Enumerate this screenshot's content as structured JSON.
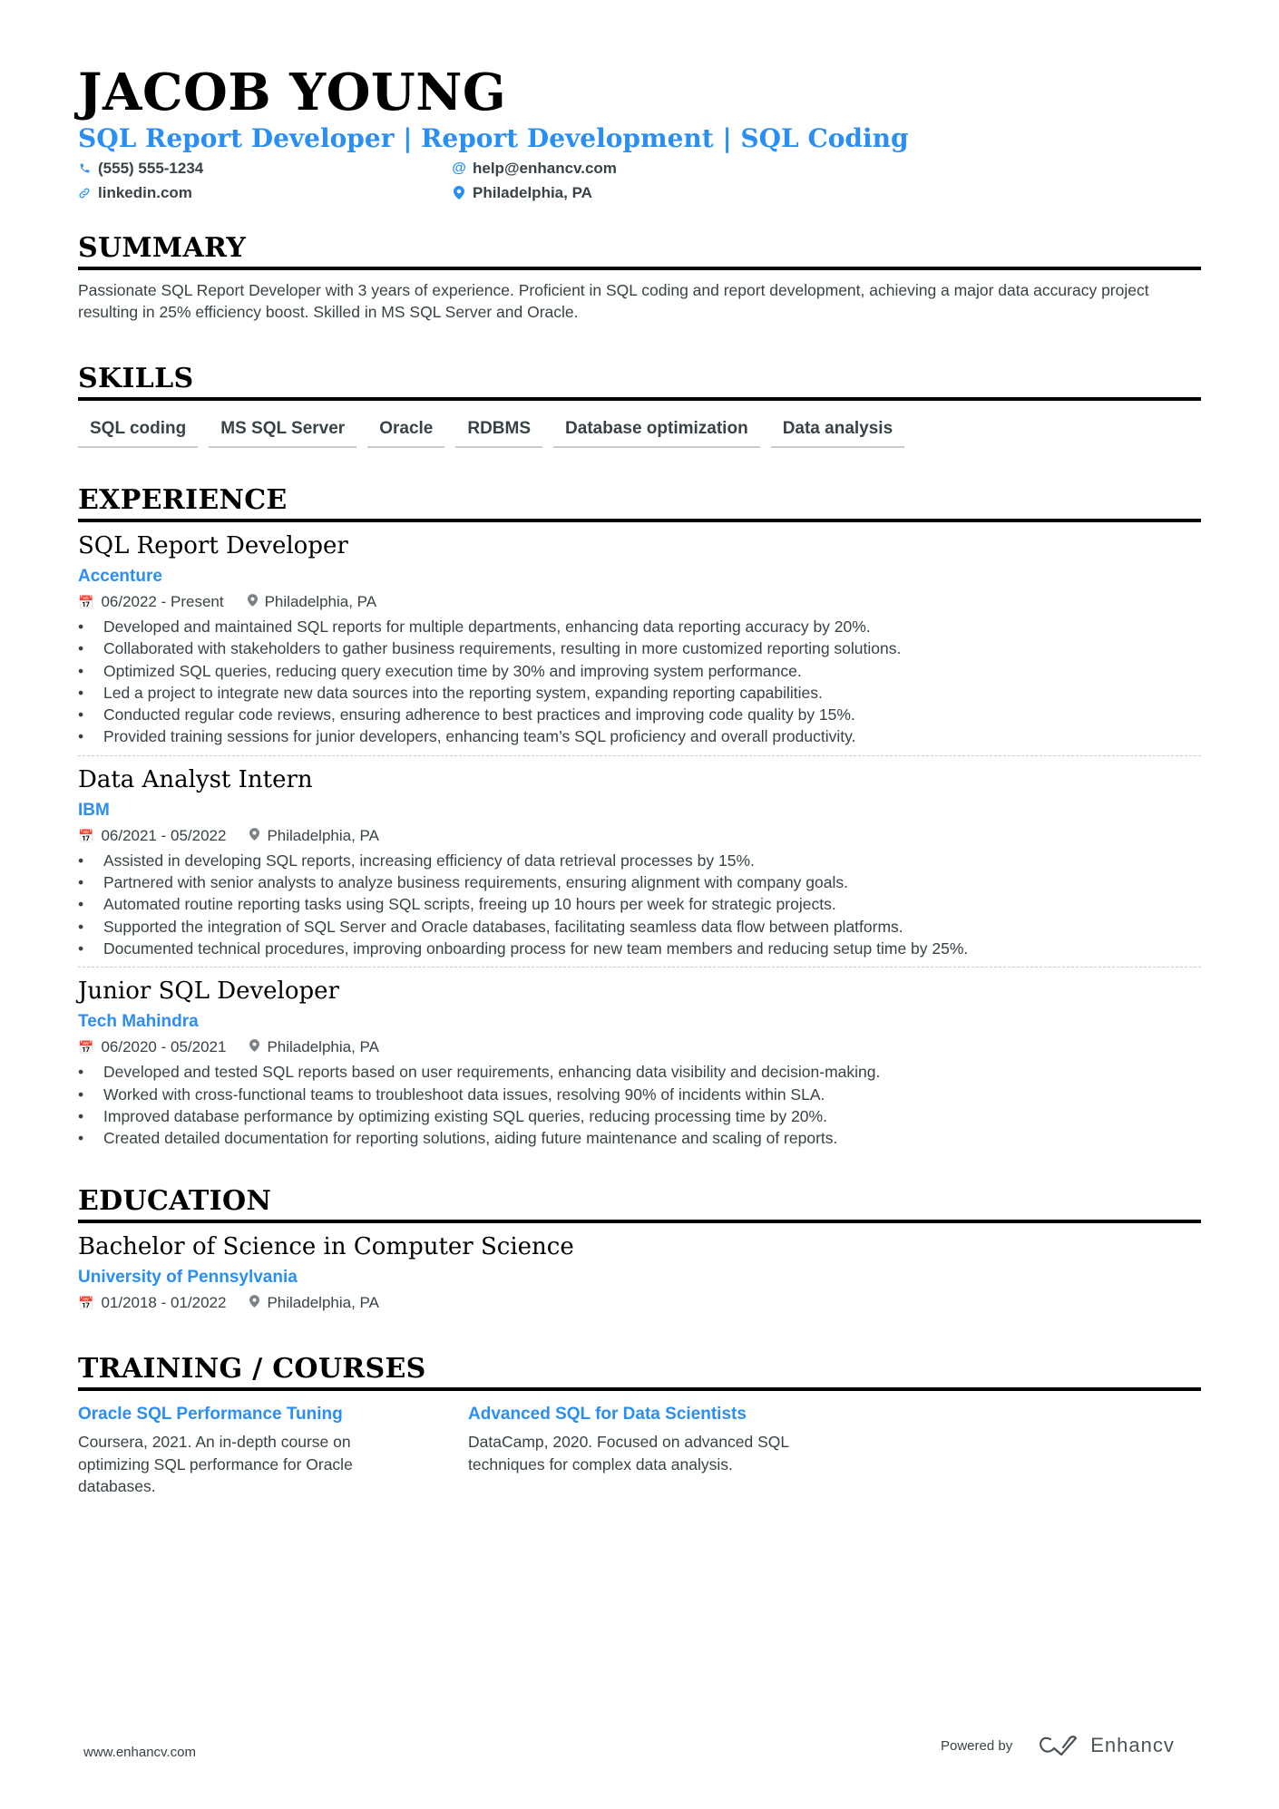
{
  "header": {
    "name": "JACOB YOUNG",
    "headline": "SQL Report Developer | Report Development | SQL Coding",
    "contacts": [
      {
        "icon": "phone-icon",
        "value": "(555) 555-1234"
      },
      {
        "icon": "at-icon",
        "value": "help@enhancv.com"
      },
      {
        "icon": "link-icon",
        "value": "linkedin.com"
      },
      {
        "icon": "location-pin-icon",
        "value": "Philadelphia, PA"
      }
    ]
  },
  "summary": {
    "title": "SUMMARY",
    "text": "Passionate SQL Report Developer with 3 years of experience. Proficient in SQL coding and report development, achieving a major data accuracy project resulting in 25% efficiency boost. Skilled in MS SQL Server and Oracle."
  },
  "skills": {
    "title": "SKILLS",
    "items": [
      "SQL coding",
      "MS SQL Server",
      "Oracle",
      "RDBMS",
      "Database optimization",
      "Data analysis"
    ]
  },
  "experience": {
    "title": "EXPERIENCE",
    "items": [
      {
        "role": "SQL Report Developer",
        "company": "Accenture",
        "dates": "06/2022 - Present",
        "location": "Philadelphia, PA",
        "bullets": [
          "Developed and maintained SQL reports for multiple departments, enhancing data reporting accuracy by 20%.",
          "Collaborated with stakeholders to gather business requirements, resulting in more customized reporting solutions.",
          "Optimized SQL queries, reducing query execution time by 30% and improving system performance.",
          "Led a project to integrate new data sources into the reporting system, expanding reporting capabilities.",
          "Conducted regular code reviews, ensuring adherence to best practices and improving code quality by 15%.",
          "Provided training sessions for junior developers, enhancing team’s SQL proficiency and overall productivity."
        ]
      },
      {
        "role": "Data Analyst Intern",
        "company": "IBM",
        "dates": "06/2021 - 05/2022",
        "location": "Philadelphia, PA",
        "bullets": [
          "Assisted in developing SQL reports, increasing efficiency of data retrieval processes by 15%.",
          "Partnered with senior analysts to analyze business requirements, ensuring alignment with company goals.",
          "Automated routine reporting tasks using SQL scripts, freeing up 10 hours per week for strategic projects.",
          "Supported the integration of SQL Server and Oracle databases, facilitating seamless data flow between platforms.",
          "Documented technical procedures, improving onboarding process for new team members and reducing setup time by 25%."
        ]
      },
      {
        "role": "Junior SQL Developer",
        "company": "Tech Mahindra",
        "dates": "06/2020 - 05/2021",
        "location": "Philadelphia, PA",
        "bullets": [
          "Developed and tested SQL reports based on user requirements, enhancing data visibility and decision-making.",
          "Worked with cross-functional teams to troubleshoot data issues, resolving 90% of incidents within SLA.",
          "Improved database performance by optimizing existing SQL queries, reducing processing time by 20%.",
          "Created detailed documentation for reporting solutions, aiding future maintenance and scaling of reports."
        ]
      }
    ]
  },
  "education": {
    "title": "EDUCATION",
    "degree": "Bachelor of Science in Computer Science",
    "school": "University of Pennsylvania",
    "dates": "01/2018 - 01/2022",
    "location": "Philadelphia, PA"
  },
  "training": {
    "title": "TRAINING / COURSES",
    "items": [
      {
        "title": "Oracle SQL Performance Tuning",
        "description": "Coursera, 2021. An in-depth course on optimizing SQL performance for Oracle databases."
      },
      {
        "title": "Advanced SQL for Data Scientists",
        "description": "DataCamp, 2020. Focused on advanced SQL techniques for complex data analysis."
      }
    ]
  },
  "footer": {
    "website": "www.enhancv.com",
    "powered_by": "Powered by",
    "brand": "Enhancv"
  },
  "colors": {
    "accent": "#2a8ef3",
    "text": "#384347",
    "heading": "#000000"
  }
}
